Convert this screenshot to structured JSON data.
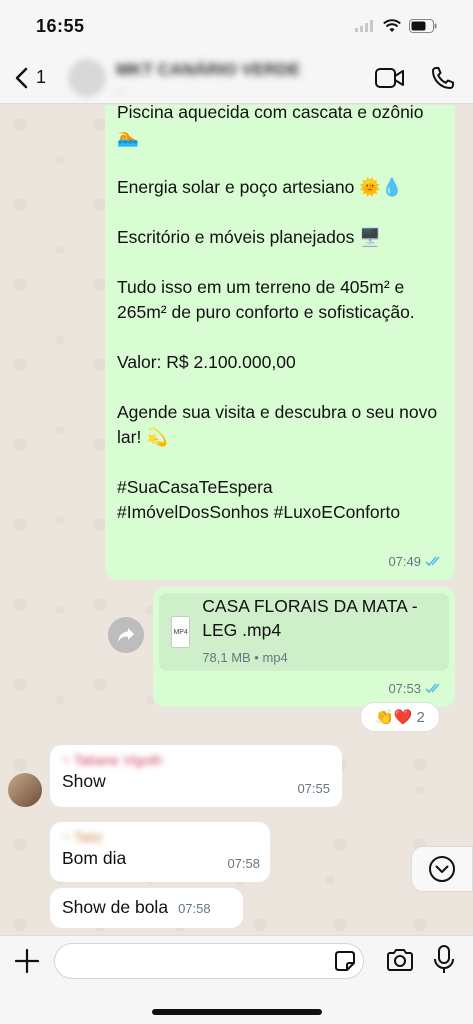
{
  "status": {
    "time": "16:55"
  },
  "header": {
    "back_count": "1",
    "contact_name": "MKT CANÁRIO VERDE",
    "contact_sub": "...",
    "video_icon": "video-call-icon",
    "phone_icon": "phone-icon"
  },
  "messages": {
    "listing": {
      "text": "Piscina aquecida com cascata e ozônio 🏊\n\nEnergia solar e poço artesiano 🌞💧\n\nEscritório e móveis planejados 🖥️\n\nTudo isso em um terreno de 405m² e 265m² de puro conforto e sofisticação.\n\nValor: R$ 2.100.000,00\n\nAgende sua visita e descubra o seu novo lar! 💫\n\n#SuaCasaTeEspera\n#ImóvelDosSonhos #LuxoEConforto",
      "time": "07:49"
    },
    "file": {
      "icon_label": "MP4",
      "name": "CASA FLORAIS DA MATA - LEG .mp4",
      "details": "78,1 MB • mp4",
      "time": "07:53",
      "reactions": "👏❤️",
      "reaction_count": "2"
    },
    "show": {
      "sender": "~ Tatiane Vigoth",
      "text": "Show",
      "time": "07:55"
    },
    "bom_dia": {
      "sender": "~ Tatiz",
      "text": "Bom dia",
      "time": "07:58"
    },
    "show_bola": {
      "text": "Show de bola",
      "time": "07:58"
    }
  },
  "input": {
    "placeholder": ""
  },
  "colors": {
    "outgoing": "#d9fdd3",
    "incoming": "#ffffff",
    "tick_blue": "#53bdeb"
  }
}
